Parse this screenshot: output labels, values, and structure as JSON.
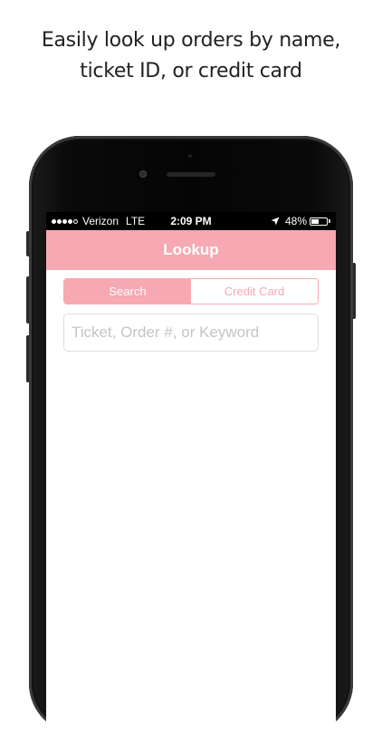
{
  "caption": {
    "line1": "Easily look up  orders by name,",
    "line2": "ticket ID, or credit card"
  },
  "status_bar": {
    "carrier": "Verizon",
    "network": "LTE",
    "time": "2:09 PM",
    "battery_percent": "48%",
    "battery_level": 0.48,
    "signal_bars_filled": 4,
    "signal_bars_total": 5
  },
  "nav": {
    "title": "Lookup"
  },
  "segmented_control": {
    "selected": "Search",
    "options": [
      "Search",
      "Credit Card"
    ]
  },
  "search": {
    "value": "",
    "placeholder": "Ticket, Order #, or Keyword"
  },
  "colors": {
    "accent": "#f6a9b3",
    "status_bar": "#000000",
    "input_border": "#dddddd",
    "placeholder": "#c4c4c8"
  },
  "icons": [
    "location-arrow-icon",
    "battery-icon",
    "signal-dots-icon"
  ]
}
